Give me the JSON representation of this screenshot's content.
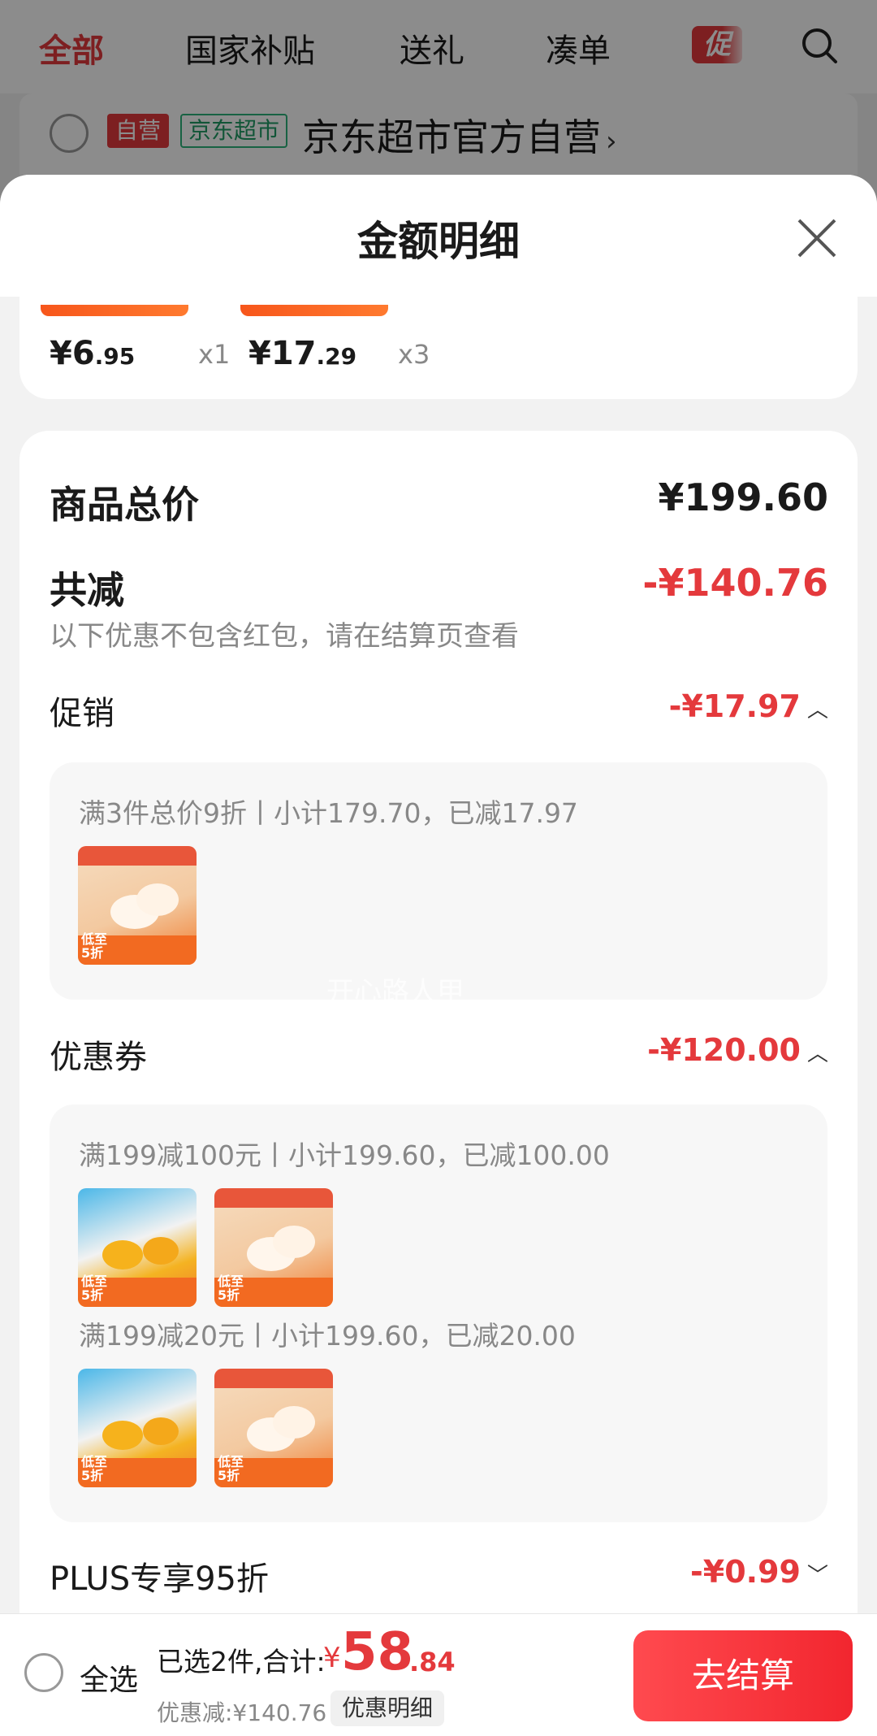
{
  "topbar": {
    "tabs": [
      "全部",
      "国家补贴",
      "送礼",
      "凑单"
    ],
    "promo_badge": "促",
    "search_icon": "search-icon"
  },
  "store": {
    "tag_self": "自营",
    "tag_market": "京东超市",
    "name": "京东超市官方自营",
    "chevron": "›"
  },
  "sheet": {
    "title": "金额明细",
    "close_icon": "close-icon",
    "items": [
      {
        "price_int": "¥6",
        "price_dec": ".95",
        "qty": "x1"
      },
      {
        "price_int": "¥17",
        "price_dec": ".29",
        "qty": "x3"
      }
    ],
    "total_label": "商品总价",
    "total_value": "¥199.60",
    "reduce_label": "共减",
    "reduce_value": "-¥140.76",
    "reduce_note": "以下优惠不包含红包，请在结算页查看",
    "promo": {
      "label": "促销",
      "value": "-¥17.97",
      "caret": "︿",
      "line": "满3件总价9折丨小计179.70，已减17.97"
    },
    "coupon": {
      "label": "优惠券",
      "value": "-¥120.00",
      "caret": "︿",
      "line1": "满199减100元丨小计199.60，已减100.00",
      "line2": "满199减20元丨小计199.60，已减20.00"
    },
    "plus": {
      "label": "PLUS专享95折",
      "value": "-¥0.99",
      "caret": "﹀"
    },
    "watermark": "开心路人甲",
    "thumb_text": "低至\n5折"
  },
  "bottom": {
    "select_all": "全选",
    "selected": "已选2件,合计:",
    "currency": "¥",
    "total_int": "58",
    "total_dec": ".84",
    "discount": "优惠减:¥140.76",
    "detail_btn": "优惠明细",
    "checkout": "去结算"
  },
  "colors": {
    "accent": "#e4393c",
    "checkout_gradient_start": "#ff4a4f",
    "market_green": "#2db37a"
  }
}
